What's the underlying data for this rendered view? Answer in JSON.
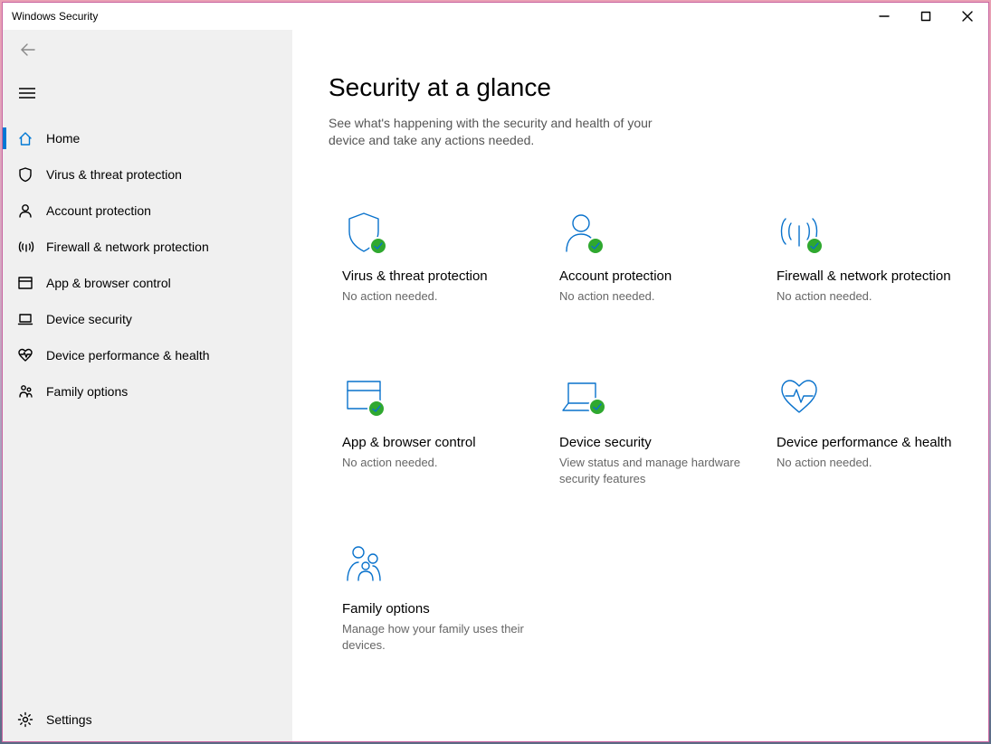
{
  "window": {
    "title": "Windows Security"
  },
  "sidebar": {
    "items": [
      {
        "label": "Home"
      },
      {
        "label": "Virus & threat protection"
      },
      {
        "label": "Account protection"
      },
      {
        "label": "Firewall & network protection"
      },
      {
        "label": "App & browser control"
      },
      {
        "label": "Device security"
      },
      {
        "label": "Device performance & health"
      },
      {
        "label": "Family options"
      }
    ],
    "settings_label": "Settings"
  },
  "main": {
    "title": "Security at a glance",
    "subtitle": "See what's happening with the security and health of your device and take any actions needed."
  },
  "cards": [
    {
      "title": "Virus & threat protection",
      "desc": "No action needed."
    },
    {
      "title": "Account protection",
      "desc": "No action needed."
    },
    {
      "title": "Firewall & network protection",
      "desc": "No action needed."
    },
    {
      "title": "App & browser control",
      "desc": "No action needed."
    },
    {
      "title": "Device security",
      "desc": "View status and manage hardware security features"
    },
    {
      "title": "Device performance & health",
      "desc": "No action needed."
    },
    {
      "title": "Family options",
      "desc": "Manage how your family uses their devices."
    }
  ]
}
